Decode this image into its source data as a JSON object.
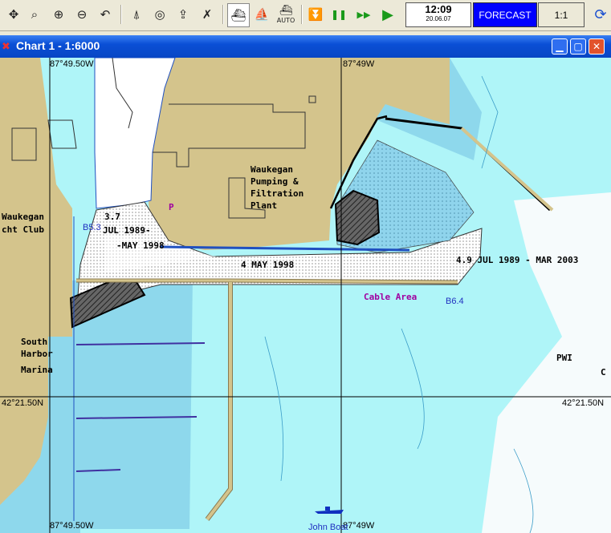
{
  "toolbar": {
    "buttons": [
      {
        "name": "select-tool-icon",
        "glyph": "✥"
      },
      {
        "name": "zoom-window-icon",
        "glyph": "⌕"
      },
      {
        "name": "zoom-in-icon",
        "glyph": "⊕"
      },
      {
        "name": "zoom-out-icon",
        "glyph": "⊖"
      },
      {
        "name": "undo-zoom-icon",
        "glyph": "↶"
      },
      {
        "name": "route-tool-icon",
        "glyph": "⍋"
      },
      {
        "name": "target-icon",
        "glyph": "◎"
      },
      {
        "name": "export-icon",
        "glyph": "⇪"
      },
      {
        "name": "delete-icon",
        "glyph": "✗"
      },
      {
        "name": "ship-centered-icon",
        "glyph": "⛴"
      },
      {
        "name": "ship-track-icon",
        "glyph": "⛵"
      },
      {
        "name": "pause-icon",
        "glyph": "❚❚"
      },
      {
        "name": "fast-forward-icon",
        "glyph": "▶▶"
      },
      {
        "name": "play-icon",
        "glyph": "▶"
      },
      {
        "name": "refresh-icon",
        "glyph": "⟳"
      }
    ],
    "auto_label": "AUTO",
    "stop_glyph": "⏬",
    "clock_time": "12:09",
    "clock_date": "20.06.07",
    "forecast_label": "FORECAST",
    "scale_label": "1:1"
  },
  "window": {
    "title": "Chart 1 - 1:6000",
    "minimize": "▁",
    "maximize": "▢",
    "close": "✕"
  },
  "chart": {
    "coords": {
      "top_left_lon": "87°49.50W",
      "top_mid_lon": "87°49W",
      "left_lat": "42°21.50N",
      "right_lat": "42°21.50N",
      "bottom_left_lon": "87°49.50W",
      "bottom_mid_lon": "87°49W"
    },
    "labels": {
      "pumping_1": "Waukegan",
      "pumping_2": "Pumping &",
      "pumping_3": "Filtration",
      "pumping_4": "Plant",
      "yacht_1": "Waukegan",
      "yacht_2": "cht Club",
      "harbor_1": "South",
      "harbor_2": "Harbor",
      "harbor_3": "Marina",
      "depth_37": "3.7",
      "jul1989": "JUL 1989-",
      "may1998a": "-MAY 1998",
      "may1998b": "4  MAY 1998",
      "jul_mar": "4.9  JUL 1989 - MAR 2003",
      "p_marker": "P",
      "b53": "B5.3",
      "cable_area": "Cable Area",
      "b64": "B6.4",
      "pwi": "PWI",
      "c_right": "C",
      "vessel": "John Boat"
    },
    "colors": {
      "land": "#d4c48c",
      "shallow": "#a8dcf0",
      "deep": "#aff5f8",
      "dredged": "#ffffff",
      "magenta": "#a000a0"
    }
  }
}
